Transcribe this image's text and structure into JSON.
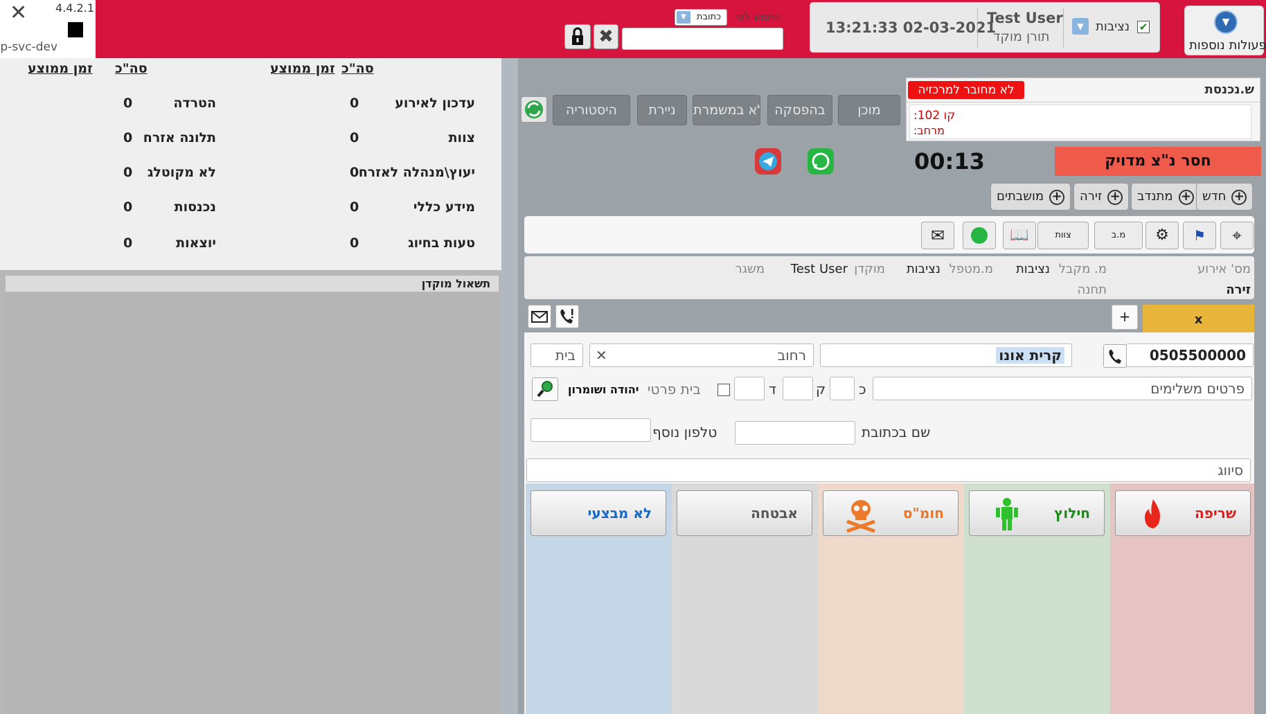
{
  "app": {
    "version": "4.4.2.1",
    "env": "op-svc-dev"
  },
  "topbar": {
    "search_label": "חיפוש לפי:",
    "search_type": "כתובת",
    "search_value": "",
    "datetime": "13:21:33  02-03-2021",
    "user_name": "Test User",
    "user_role": "תורן מוקד",
    "role_select": "נציבות",
    "more_actions": "פעולות נוספות"
  },
  "stats": {
    "headers": [
      "סה\"כ",
      "זמן ממוצע",
      "סה\"כ",
      "זמן ממוצע"
    ],
    "right_col": [
      {
        "label": "עדכון לאירוע",
        "value": "0"
      },
      {
        "label": "צוות",
        "value": "0"
      },
      {
        "label": "יעוץ\\מנהלה לאזרח",
        "value": "0"
      },
      {
        "label": "מידע כללי",
        "value": "0"
      },
      {
        "label": "טעות בחיוג",
        "value": "0"
      }
    ],
    "left_col": [
      {
        "label": "הטרדה",
        "value": "0"
      },
      {
        "label": "תלונה אזרח",
        "value": "0"
      },
      {
        "label": "לא מקוטלג",
        "value": "0"
      },
      {
        "label": "נכנסות",
        "value": "0"
      },
      {
        "label": "יוצאות",
        "value": "0"
      }
    ]
  },
  "prior_query": {
    "title": "תשאול מוקדן"
  },
  "incoming": {
    "title": "ש.נכנסת",
    "status_badge": "לא מחובר למרכזיה",
    "line": "קו 102:",
    "extension": "מרחב:"
  },
  "tabs": [
    "מוכן",
    "בהפסקה",
    "לא במשמרת",
    "ניירת",
    "היסטוריה"
  ],
  "alert": "חסר נ\"צ מדויק",
  "timer": "00:13",
  "new_buttons": [
    "חדש",
    "מתנדב",
    "זירה",
    "מושבתים"
  ],
  "toolbar_labels": {
    "mb": "מ.ב",
    "teams": "צוות"
  },
  "info": {
    "event_no_label": "מס' אירוע",
    "receiver_label": "מ. מקבל",
    "receiver_value": "נציבות",
    "handler_label": "מ.מטפל",
    "handler_value": "נציבות",
    "dispatcher_label": "מוקדן",
    "dispatcher_value": "Test User",
    "sender_label": "משגר",
    "scene_value": "זירה",
    "station_label": "תחנה"
  },
  "form": {
    "tab_label": "x",
    "phone": "0505500000",
    "city": "קרית אונו",
    "street_placeholder": "רחוב",
    "house_placeholder": "בית",
    "details_placeholder": "פרטים משלימים",
    "entrance_label": "כ",
    "floor_label": "ק",
    "apt_label": "ד",
    "private_house_label": "בית פרטי",
    "region": "יהודה ושומרון",
    "addr_name_label": "שם בכתובת",
    "extra_phone_label": "טלפון נוסף",
    "classification_placeholder": "סיווג"
  },
  "categories": [
    {
      "label": "שריפה",
      "color": "#e31a1a",
      "bg": "#e6c4c4"
    },
    {
      "label": "חילוץ",
      "color": "#1a8a1a",
      "bg": "#cfe0cf"
    },
    {
      "label": "חומ\"ס",
      "color": "#e8762a",
      "bg": "#efd9cb"
    },
    {
      "label": "אבטחה",
      "color": "#555555",
      "bg": "#d9d9d9"
    },
    {
      "label": "לא מבצעי",
      "color": "#1569c7",
      "bg": "#c5d7e6"
    }
  ]
}
